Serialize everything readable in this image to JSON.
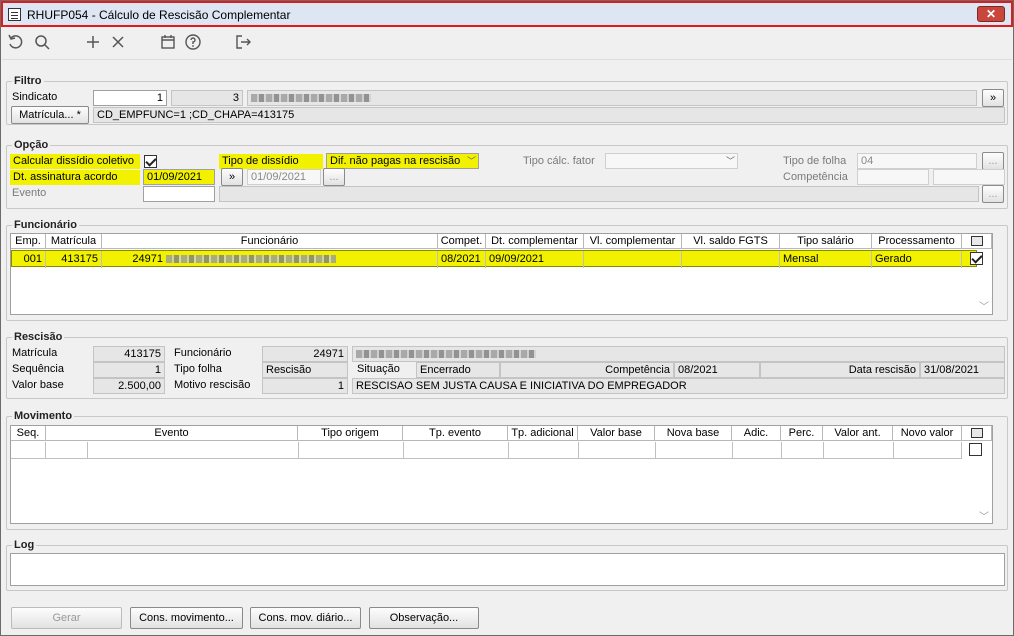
{
  "window": {
    "title": "RHUFP054 - Cálculo de Rescisão Complementar",
    "close_label": "✕"
  },
  "toolbar": {
    "icons": [
      "undo-icon",
      "search-icon",
      "add-icon",
      "delete-icon",
      "calendar-icon",
      "help-icon",
      "exit-icon"
    ]
  },
  "filtro": {
    "title": "Filtro",
    "sindicato_label": "Sindicato",
    "sindicato_value": "1",
    "sindicato_code": "3",
    "matricula_button": "Matrícula... *",
    "matricula_value": "CD_EMPFUNC=1 ;CD_CHAPA=413175",
    "more_button": "»"
  },
  "opcao": {
    "title": "Opção",
    "calcular_label": "Calcular dissídio coletivo",
    "calcular_checked": true,
    "tipo_dissidio_label": "Tipo de dissídio",
    "tipo_dissidio_value": "Dif. não pagas na rescisão",
    "tipo_calc_label": "Tipo cálc. fator",
    "tipo_calc_value": "",
    "tipo_folha_label": "Tipo de folha",
    "tipo_folha_value": "04",
    "dt_assinatura_label": "Dt. assinatura acordo",
    "dt_assinatura_value": "01/09/2021",
    "dt_secondary_value": "01/09/2021",
    "competencia_label": "Competência",
    "evento_label": "Evento",
    "arrow_button": "»",
    "ellipsis_button": "..."
  },
  "funcionario": {
    "title": "Funcionário",
    "columns": [
      "Emp.",
      "Matrícula",
      "Funcionário",
      "Compet.",
      "Dt. complementar",
      "Vl. complementar",
      "Vl. saldo FGTS",
      "Tipo salário",
      "Processamento"
    ],
    "rows": [
      {
        "emp": "001",
        "matricula": "413175",
        "func_code": "24971",
        "compet": "08/2021",
        "dt_complementar": "09/09/2021",
        "vl_complementar": "",
        "vl_saldo": "",
        "tipo_salario": "Mensal",
        "processamento": "Gerado",
        "checked": true
      }
    ]
  },
  "rescisao": {
    "title": "Rescisão",
    "matricula_label": "Matrícula",
    "matricula_value": "413175",
    "funcionario_label": "Funcionário",
    "funcionario_code": "24971",
    "sequencia_label": "Sequência",
    "sequencia_value": "1",
    "tipo_folha_label": "Tipo folha",
    "tipo_folha_value": "Rescisão",
    "situacao_label": "Situação",
    "situacao_value": "Encerrado",
    "competencia_label": "Competência",
    "competencia_value": "08/2021",
    "data_rescisao_label": "Data rescisão",
    "data_rescisao_value": "31/08/2021",
    "valor_base_label": "Valor base",
    "valor_base_value": "2.500,00",
    "motivo_label": "Motivo rescisão",
    "motivo_code": "1",
    "motivo_value": "RESCISAO SEM JUSTA CAUSA E INICIATIVA DO EMPREGADOR"
  },
  "movimento": {
    "title": "Movimento",
    "columns": [
      "Seq.",
      "Evento",
      "Tipo origem",
      "Tp. evento",
      "Tp. adicional",
      "Valor base",
      "Nova base",
      "Adic.",
      "Perc.",
      "Valor ant.",
      "Novo valor"
    ]
  },
  "log": {
    "title": "Log",
    "value": ""
  },
  "buttons": {
    "gerar": "Gerar",
    "cons_movimento": "Cons. movimento...",
    "cons_mov_diario": "Cons. mov. diário...",
    "observacao": "Observação..."
  }
}
